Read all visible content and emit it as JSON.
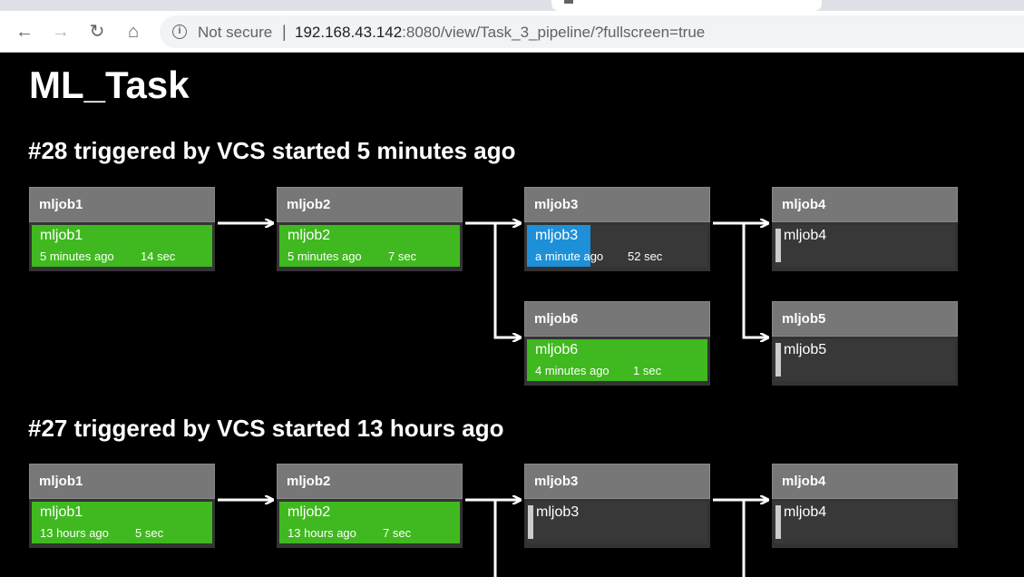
{
  "browser": {
    "security": "Not secure",
    "separator": "|",
    "url_host": "192.168.43.142",
    "url_rest": ":8080/view/Task_3_pipeline/?fullscreen=true"
  },
  "page": {
    "title": "ML_Task"
  },
  "builds": [
    {
      "title": "#28 triggered by VCS started 5 minutes ago",
      "jobs": [
        {
          "header": "mljob1",
          "name": "mljob1",
          "status": "success",
          "time": "5 minutes ago",
          "duration": "14 sec"
        },
        {
          "header": "mljob2",
          "name": "mljob2",
          "status": "success",
          "time": "5 minutes ago",
          "duration": "7 sec"
        },
        {
          "header": "mljob3",
          "name": "mljob3",
          "status": "running",
          "progress": 0.35,
          "time": "a minute ago",
          "duration": "52 sec"
        },
        {
          "header": "mljob4",
          "name": "mljob4",
          "status": "pending"
        },
        {
          "header": "mljob6",
          "name": "mljob6",
          "status": "success",
          "time": "4 minutes ago",
          "duration": "1 sec"
        },
        {
          "header": "mljob5",
          "name": "mljob5",
          "status": "pending"
        }
      ]
    },
    {
      "title": "#27 triggered by VCS started 13 hours ago",
      "jobs": [
        {
          "header": "mljob1",
          "name": "mljob1",
          "status": "success",
          "time": "13 hours ago",
          "duration": "5 sec"
        },
        {
          "header": "mljob2",
          "name": "mljob2",
          "status": "success",
          "time": "13 hours ago",
          "duration": "7 sec"
        },
        {
          "header": "mljob3",
          "name": "mljob3",
          "status": "pending"
        },
        {
          "header": "mljob4",
          "name": "mljob4",
          "status": "pending"
        }
      ]
    }
  ],
  "colors": {
    "success": "#3fb91f",
    "running": "#1e90d8",
    "pending": "#383838",
    "header": "#777777"
  }
}
